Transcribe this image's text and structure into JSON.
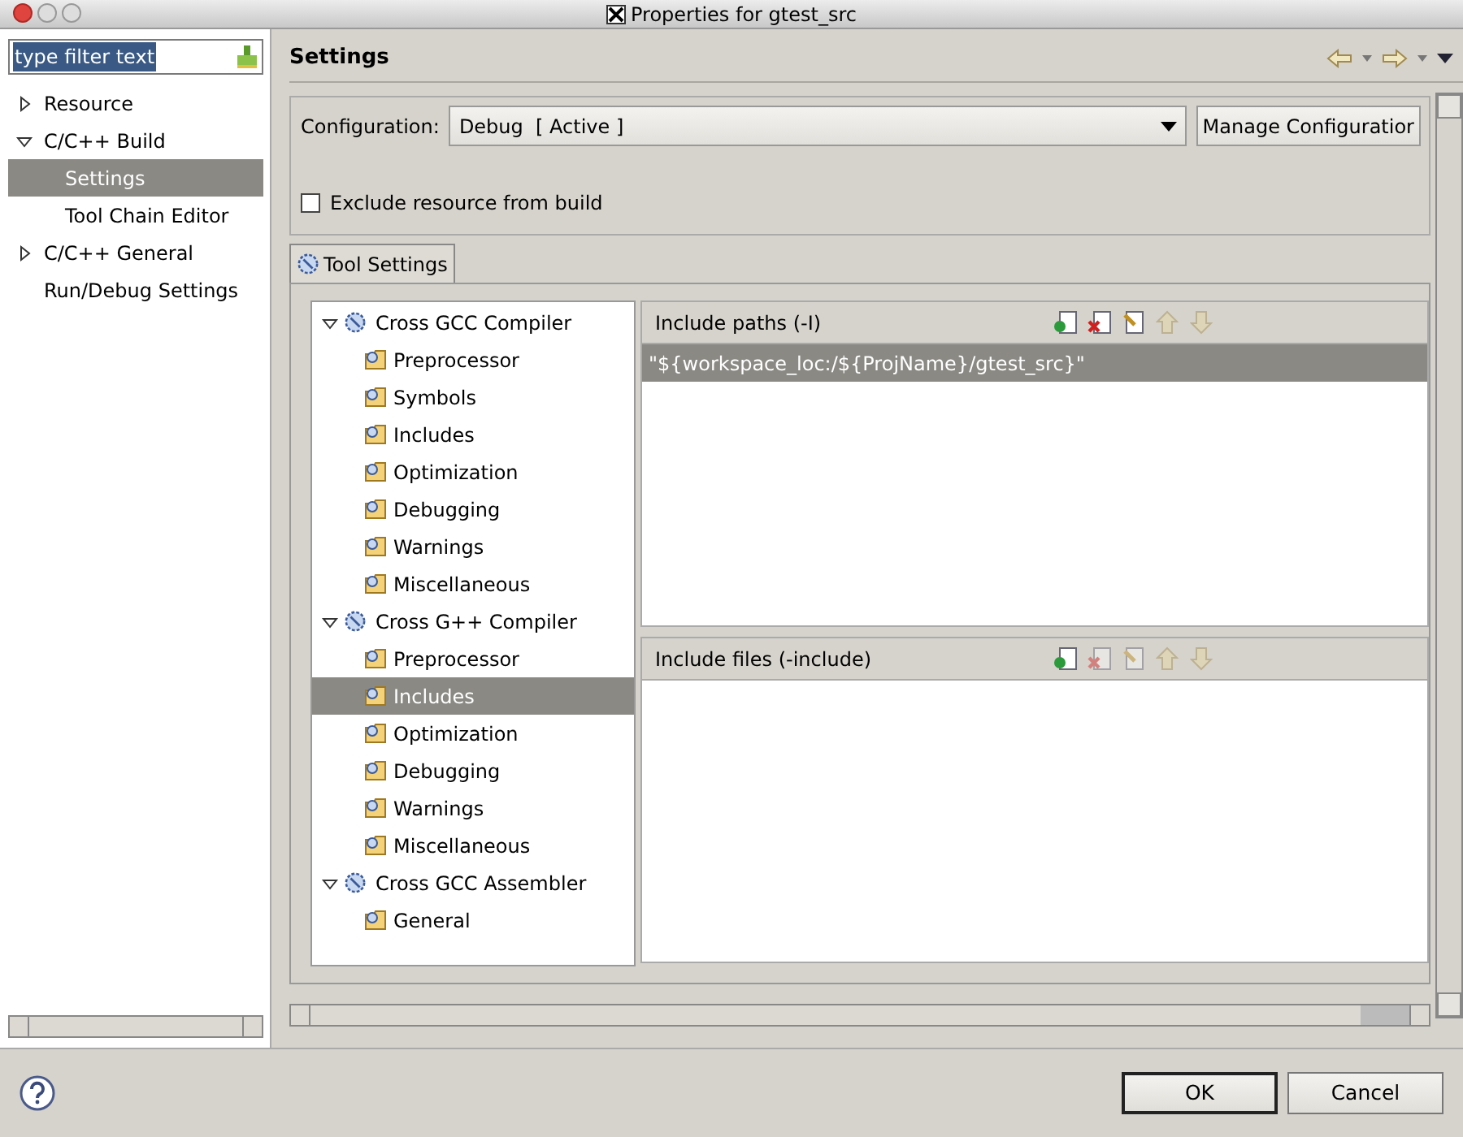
{
  "window": {
    "title": "Properties for gtest_src"
  },
  "filter": {
    "value": "type filter text"
  },
  "nav": [
    {
      "label": "Resource",
      "expanded": false,
      "selected": false
    },
    {
      "label": "C/C++ Build",
      "expanded": true,
      "selected": false,
      "children": [
        {
          "label": "Settings",
          "selected": true
        },
        {
          "label": "Tool Chain Editor",
          "selected": false
        }
      ]
    },
    {
      "label": "C/C++ General",
      "expanded": false,
      "selected": false
    },
    {
      "label": "Run/Debug Settings",
      "selected": false
    }
  ],
  "page_title": "Settings",
  "configuration": {
    "label": "Configuration:",
    "value": "Debug  [ Active ]",
    "manage_button": "Manage Configuratior"
  },
  "exclude": {
    "label": "Exclude resource from build",
    "checked": false
  },
  "tabs": [
    {
      "label": "Tool Settings",
      "selected": true
    }
  ],
  "tools": [
    {
      "label": "Cross GCC Compiler",
      "expanded": true,
      "children": [
        {
          "label": "Preprocessor",
          "selected": false
        },
        {
          "label": "Symbols",
          "selected": false
        },
        {
          "label": "Includes",
          "selected": false
        },
        {
          "label": "Optimization",
          "selected": false
        },
        {
          "label": "Debugging",
          "selected": false
        },
        {
          "label": "Warnings",
          "selected": false
        },
        {
          "label": "Miscellaneous",
          "selected": false
        }
      ]
    },
    {
      "label": "Cross G++ Compiler",
      "expanded": true,
      "children": [
        {
          "label": "Preprocessor",
          "selected": false
        },
        {
          "label": "Includes",
          "selected": true
        },
        {
          "label": "Optimization",
          "selected": false
        },
        {
          "label": "Debugging",
          "selected": false
        },
        {
          "label": "Warnings",
          "selected": false
        },
        {
          "label": "Miscellaneous",
          "selected": false
        }
      ]
    },
    {
      "label": "Cross GCC Assembler",
      "expanded": true,
      "children": [
        {
          "label": "General",
          "selected": false
        }
      ]
    }
  ],
  "lists": [
    {
      "title": "Include paths (-I)",
      "tools": [
        {
          "kind": "add",
          "disabled": false
        },
        {
          "kind": "delete",
          "disabled": false
        },
        {
          "kind": "edit",
          "disabled": false
        },
        {
          "kind": "up",
          "disabled": true
        },
        {
          "kind": "down",
          "disabled": true
        }
      ],
      "items": [
        {
          "text": "\"${workspace_loc:/${ProjName}/gtest_src}\"",
          "selected": true
        }
      ]
    },
    {
      "title": "Include files (-include)",
      "tools": [
        {
          "kind": "add",
          "disabled": false
        },
        {
          "kind": "delete",
          "disabled": true
        },
        {
          "kind": "edit",
          "disabled": true
        },
        {
          "kind": "up",
          "disabled": true
        },
        {
          "kind": "down",
          "disabled": true
        }
      ]
    }
  ],
  "buttons": [
    {
      "label": "OK",
      "default": true
    },
    {
      "label": "Cancel",
      "default": false
    }
  ]
}
